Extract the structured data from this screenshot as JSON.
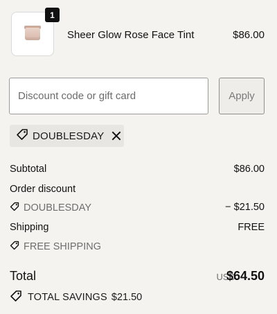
{
  "product": {
    "quantity": "1",
    "name": "Sheer Glow Rose Face Tint",
    "price": "$86.00"
  },
  "discount": {
    "placeholder": "Discount code or gift card",
    "apply_label": "Apply",
    "applied_code": "DOUBLESDAY"
  },
  "summary": {
    "subtotal_label": "Subtotal",
    "subtotal_value": "$86.00",
    "order_discount_label": "Order discount",
    "order_discount_code": "DOUBLESDAY",
    "order_discount_value": "− $21.50",
    "shipping_label": "Shipping",
    "shipping_value": "FREE",
    "shipping_code": "FREE SHIPPING"
  },
  "total": {
    "label": "Total",
    "currency": "USD",
    "amount": "$64.50",
    "savings_label": "TOTAL SAVINGS",
    "savings_amount": "$21.50"
  }
}
